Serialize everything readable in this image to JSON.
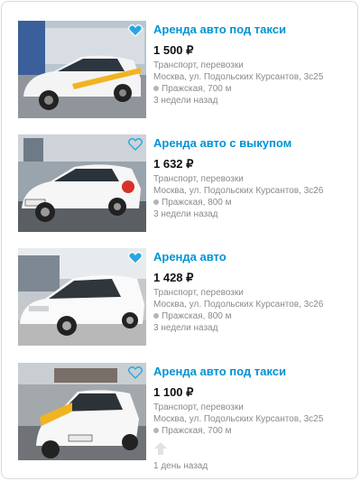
{
  "listings": [
    {
      "title": "Аренда авто под такси",
      "price": "1 500 ₽",
      "category": "Транспорт, перевозки",
      "address": "Москва, ул. Подольских Курсантов, 3с25",
      "metro": "Пражская, 700 м",
      "date": "3 недели назад",
      "favorite": true
    },
    {
      "title": "Аренда авто с выкупом",
      "price": "1 632 ₽",
      "category": "Транспорт, перевозки",
      "address": "Москва, ул. Подольских Курсантов, 3с26",
      "metro": "Пражская, 800 м",
      "date": "3 недели назад",
      "favorite": false
    },
    {
      "title": "Аренда авто",
      "price": "1 428 ₽",
      "category": "Транспорт, перевозки",
      "address": "Москва, ул. Подольских Курсантов, 3с26",
      "metro": "Пражская, 800 м",
      "date": "3 недели назад",
      "favorite": true
    },
    {
      "title": "Аренда авто под такси",
      "price": "1 100 ₽",
      "category": "Транспорт, перевозки",
      "address": "Москва, ул. Подольских Курсантов, 3с25",
      "metro": "Пражская, 700 м",
      "date": "1 день назад",
      "favorite": false
    }
  ],
  "colors": {
    "link": "#0093d5",
    "metro_dot": "#b5b5b5"
  }
}
